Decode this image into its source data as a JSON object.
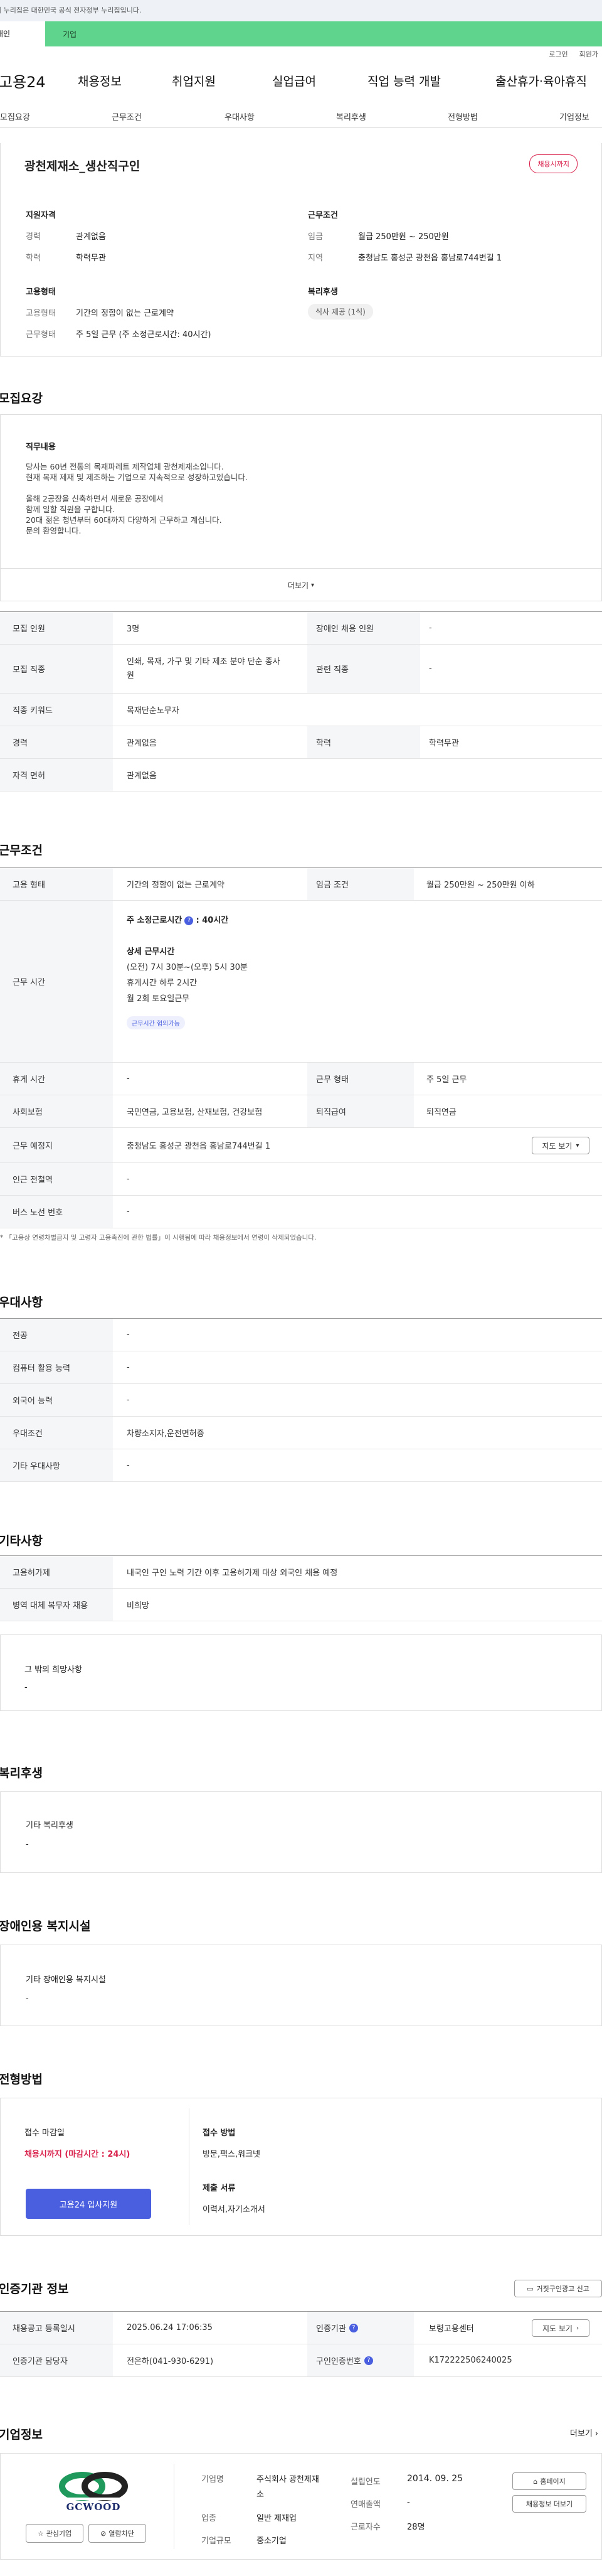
{
  "gov_banner": "이 누리집은 대한민국 공식 전자정부 누리집입니다.",
  "top_tabs": {
    "personal": "개인",
    "company": "기업"
  },
  "util": {
    "login": "로그인",
    "join": "회원가"
  },
  "gnb": {
    "logo": "고용24",
    "menu": [
      "채용정보",
      "취업지원",
      "실업급여",
      "직업 능력 개발",
      "출산휴가·육아휴직"
    ]
  },
  "subnav": [
    "모집요강",
    "근무조건",
    "우대사항",
    "복리후생",
    "전형방법",
    "기업정보"
  ],
  "summary": {
    "title": "광천제재소_생산직구인",
    "badge": "채용시까지",
    "qual_title": "지원자격",
    "career_k": "경력",
    "career_v": "관계없음",
    "edu_k": "학력",
    "edu_v": "학력무관",
    "cond_title": "근무조건",
    "pay_k": "임금",
    "pay_v": "월급 250만원 ~ 250만원",
    "loc_k": "지역",
    "loc_v": "충청남도 홍성군 광천읍 홍남로744번길 1",
    "emp_title": "고용형태",
    "emptype_k": "고용형태",
    "emptype_v": "기간의 정함이 없는 근로계약",
    "work_k": "근무형태",
    "work_v": "주 5일 근무 (주 소정근로시간: 40시간)",
    "welfare_title": "복리후생",
    "welfare_tag": "식사 제공 (1식)"
  },
  "recruit": {
    "title": "모집요강",
    "duty_title": "직무내용",
    "duty_lines": [
      "당사는 60년 전통의 목재파레트 제작업체 광천제재소입니다.",
      "현재 목재 제재 및 제조하는 기업으로 지속적으로 성장하고있습니다.",
      "",
      "올해 2공장을 신축하면서 새로운 공장에서",
      "함께 일할 직원을 구합니다.",
      "20대 젊은 청년부터 60대까지 다양하게 근무하고 계십니다.",
      "문의 환영합니다."
    ],
    "more": "더보기",
    "rows": {
      "count_k": "모집 인원",
      "count_v": "3명",
      "disabled_k": "장애인 채용 인원",
      "disabled_v": "-",
      "job_k": "모집 직종",
      "job_v": "인쇄, 목재, 가구 및 기타 제조 분야 단순 종사원",
      "rel_k": "관련 직종",
      "rel_v": "-",
      "kw_k": "직종 키워드",
      "kw_v": "목재단순노무자",
      "car_k": "경력",
      "car_v": "관계없음",
      "edu_k": "학력",
      "edu_v": "학력무관",
      "lic_k": "자격 면허",
      "lic_v": "관계없음"
    }
  },
  "work": {
    "title": "근무조건",
    "type_k": "고용 형태",
    "type_v": "기간의 정함이 없는 근로계약",
    "pay_k": "임금 조건",
    "pay_v": "월급 250만원 ~ 250만원 이하",
    "time_k": "근무 시간",
    "time_head": "주 소정근로시간",
    "time_hours": ": 40시간",
    "detail_title": "상세 근무시간",
    "detail_lines": [
      "(오전) 7시 30분~(오후) 5시 30분",
      "휴게시간 하루 2시간",
      "월 2회 토요일근무"
    ],
    "tag": "근무시간 협의가능",
    "rest_k": "휴게 시간",
    "rest_v": "-",
    "form_k": "근무 형태",
    "form_v": "주 5일 근무",
    "ins_k": "사회보험",
    "ins_v": "국민연금, 고용보험, 산재보험, 건강보험",
    "ret_k": "퇴직급여",
    "ret_v": "퇴직연금",
    "place_k": "근무 예정지",
    "place_v": "충청남도 홍성군 광천읍 홍남로744번길 1",
    "map_btn": "지도 보기",
    "sub_k": "인근 전철역",
    "sub_v": "-",
    "bus_k": "버스 노선 번호",
    "bus_v": "-",
    "note": "「고용상 연령차별금지 및 고령자 고용촉진에 관한 법률」이 시행됨에 따라 채용정보에서 연령이 삭제되었습니다."
  },
  "pref": {
    "title": "우대사항",
    "rows": [
      {
        "k": "전공",
        "v": "-"
      },
      {
        "k": "컴퓨터 활용 능력",
        "v": "-"
      },
      {
        "k": "외국어 능력",
        "v": "-"
      },
      {
        "k": "우대조건",
        "v": "차량소지자,운전면허증"
      },
      {
        "k": "기타 우대사항",
        "v": "-"
      }
    ]
  },
  "etc": {
    "title": "기타사항",
    "rows": [
      {
        "k": "고용허가제",
        "v": "내국인 구인 노력 기간 이후 고용허가제 대상 외국인 채용 예정"
      },
      {
        "k": "병역 대체 복무자 채용",
        "v": "비희망"
      }
    ],
    "other_title": "그 밖의 희망사항",
    "other_v": "-"
  },
  "welfare": {
    "title": "복리후생",
    "box_title": "기타 복리후생",
    "box_v": "-"
  },
  "disab": {
    "title": "장애인용 복지시설",
    "box_title": "기타 장애인용 복지시설",
    "box_v": "-"
  },
  "process": {
    "title": "전형방법",
    "deadline_title": "접수 마감일",
    "deadline_v": "채용시까지 (마감시간 : 24시)",
    "apply_btn": "고용24 입사지원",
    "method_title": "접수 방법",
    "method_v": "방문,팩스,워크넷",
    "doc_title": "제출 서류",
    "doc_v": "이력서,자기소개서"
  },
  "cert": {
    "title": "인증기관 정보",
    "report_btn": "거짓구인광고 신고",
    "reg_k": "채용공고 등록일시",
    "reg_v": "2025.06.24 17:06:35",
    "org_k": "인증기관",
    "org_v": "보령고용센터",
    "map_btn": "지도 보기",
    "mgr_k": "인증기관 담당자",
    "mgr_v": "전은하(041-930-6291)",
    "num_k": "구인인증번호",
    "num_v": "K172222506240025"
  },
  "company": {
    "title": "기업정보",
    "more": "더보기",
    "logo_text": "GCWOOD",
    "interest": "관심기업",
    "block": "열람차단",
    "name_k": "기업명",
    "name_v": "주식회사 광천제재소",
    "ind_k": "업종",
    "ind_v": "일반 제재업",
    "size_k": "기업규모",
    "size_v": "중소기업",
    "est_k": "설립연도",
    "est_v": "2014. 09. 25",
    "sales_k": "연매출액",
    "sales_v": "-",
    "emp_k": "근로자수",
    "emp_v": "28명",
    "homepage": "홈페이지",
    "jobs": "채용정보 더보기"
  },
  "colors": {
    "green": "#5fd48c",
    "red": "#d9204b",
    "blue": "#4a5fe0"
  }
}
